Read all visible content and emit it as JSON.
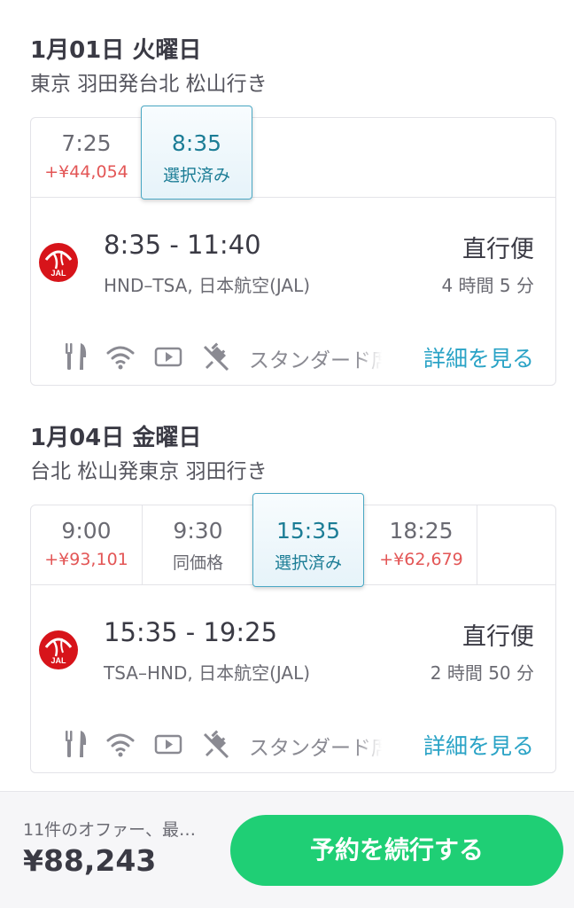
{
  "outbound": {
    "date": "1月01日 火曜日",
    "route": "東京 羽田発台北 松山行き",
    "slots": [
      {
        "time": "7:25",
        "price": "+¥44,054",
        "selected": false
      },
      {
        "time": "8:35",
        "price": "選択済み",
        "selected": true
      }
    ],
    "flight": {
      "times": "8:35 - 11:40",
      "code": "HND–TSA, 日本航空(JAL)",
      "type": "直行便",
      "duration": "4 時間 5 分",
      "fare": "スタンダード席",
      "details_label": "詳細を見る"
    }
  },
  "return": {
    "date": "1月04日 金曜日",
    "route": "台北 松山発東京 羽田行き",
    "slots": [
      {
        "time": "9:00",
        "price": "+¥93,101",
        "selected": false
      },
      {
        "time": "9:30",
        "price": "同価格",
        "selected": false
      },
      {
        "time": "15:35",
        "price": "選択済み",
        "selected": true
      },
      {
        "time": "18:25",
        "price": "+¥62,679",
        "selected": false
      }
    ],
    "flight": {
      "times": "15:35 - 19:25",
      "code": "TSA–HND, 日本航空(JAL)",
      "type": "直行便",
      "duration": "2 時間 50 分",
      "fare": "スタンダード席",
      "details_label": "詳細を見る"
    }
  },
  "airline_logo_text": "JAL",
  "amenity_icons": [
    "meal-icon",
    "wifi-icon",
    "video-icon",
    "no-power-icon"
  ],
  "footer": {
    "offers": "11件のオファー、最…",
    "total": "¥88,243",
    "cta_label": "予約を続行する"
  },
  "colors": {
    "accent": "#2aa3c6",
    "selected_text": "#1c7d96",
    "price_up": "#e35656",
    "cta": "#1fcf75",
    "jal_red": "#d7141a"
  }
}
